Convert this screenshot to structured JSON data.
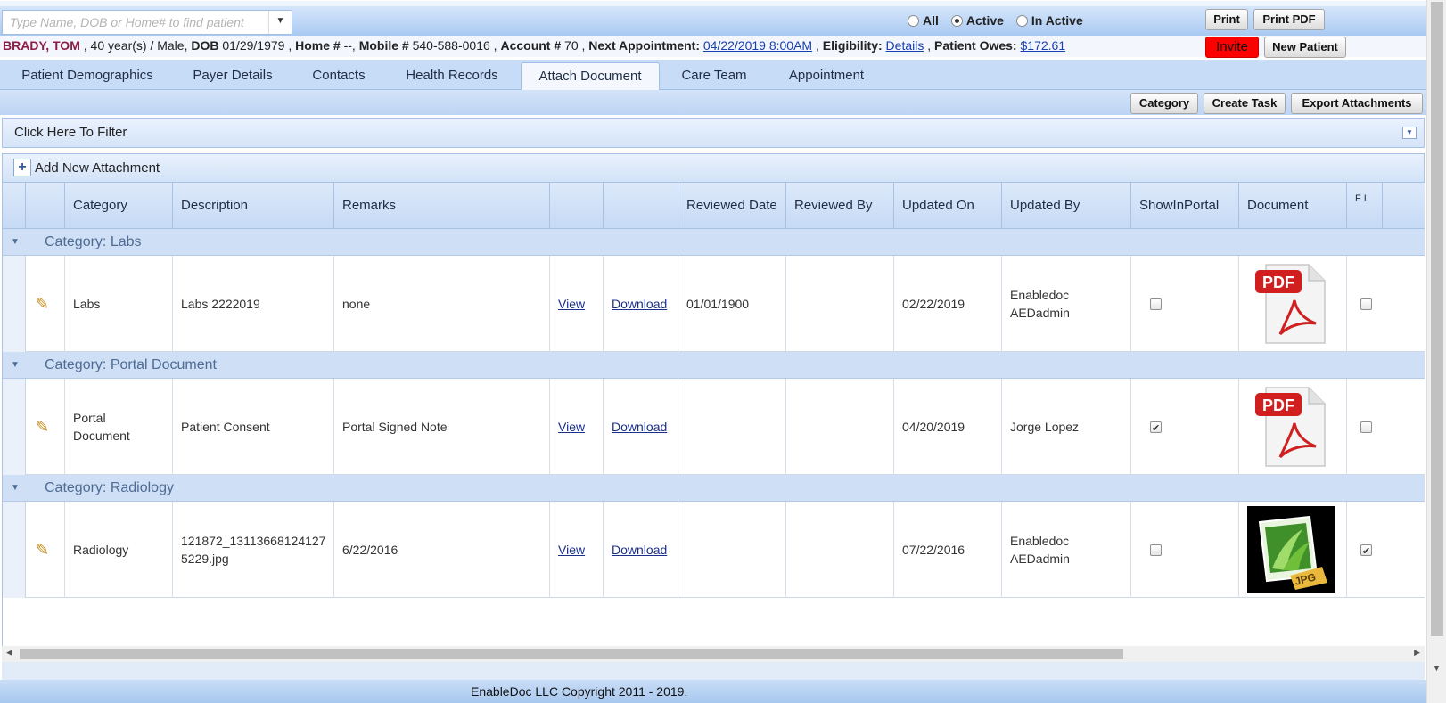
{
  "search": {
    "placeholder": "Type Name, DOB or Home# to find patient"
  },
  "status_filter": {
    "options": [
      "All",
      "Active",
      "In Active"
    ],
    "selected": "Active"
  },
  "top_buttons": {
    "print": "Print",
    "print_pdf": "Print PDF",
    "invite": "Invite",
    "new_patient": "New Patient"
  },
  "patient": {
    "name": "BRADY, TOM",
    "age_sex": " , 40 year(s) / Male, ",
    "dob_label": "DOB",
    "dob": " 01/29/1979 , ",
    "home_label": "Home #",
    "home": " --, ",
    "mobile_label": "Mobile #",
    "mobile": " 540-588-0016 , ",
    "account_label": "Account #",
    "account": " 70 , ",
    "next_appt_label": "Next Appointment:",
    "next_appt": "04/22/2019 8:00AM",
    "sep1": " , ",
    "eligibility_label": "Eligibility:",
    "eligibility": "Details",
    "sep2": " , ",
    "owes_label": "Patient Owes:",
    "owes": "$172.61"
  },
  "tabs": [
    {
      "label": "Patient Demographics"
    },
    {
      "label": "Payer Details"
    },
    {
      "label": "Contacts"
    },
    {
      "label": "Health Records"
    },
    {
      "label": "Attach Document",
      "active": true
    },
    {
      "label": "Care Team"
    },
    {
      "label": "Appointment"
    }
  ],
  "toolbar": {
    "category": "Category",
    "create_task": "Create Task",
    "export": "Export Attachments"
  },
  "filter": {
    "label": "Click Here To Filter"
  },
  "add_attachment": {
    "label": "Add New Attachment"
  },
  "table": {
    "columns": [
      "Category",
      "Description",
      "Remarks",
      "",
      "",
      "Reviewed Date",
      "Reviewed By",
      "Updated On",
      "Updated By",
      "ShowInPortal",
      "Document",
      "F I"
    ],
    "groups": [
      {
        "label": "Category: Labs",
        "row": {
          "category": "Labs",
          "description": "Labs 2222019",
          "remarks": "none",
          "view": "View",
          "download": "Download",
          "reviewed_date": "01/01/1900",
          "reviewed_by": "",
          "updated_on": "02/22/2019",
          "updated_by": "Enabledoc AEDadmin",
          "show_in_portal": false,
          "document_type": "PDF",
          "last_checked": false
        }
      },
      {
        "label": "Category: Portal Document",
        "row": {
          "category": "Portal Document",
          "description": "Patient Consent",
          "remarks": "Portal Signed Note",
          "view": "View",
          "download": "Download",
          "reviewed_date": "",
          "reviewed_by": "",
          "updated_on": "04/20/2019",
          "updated_by": "Jorge Lopez",
          "show_in_portal": true,
          "document_type": "PDF",
          "last_checked": false
        }
      },
      {
        "label": "Category: Radiology",
        "row": {
          "category": "Radiology",
          "description": "121872_131136681241275229.jpg",
          "remarks": "6/22/2016",
          "view": "View",
          "download": "Download",
          "reviewed_date": "",
          "reviewed_by": "",
          "updated_on": "07/22/2016",
          "updated_by": "Enabledoc AEDadmin",
          "show_in_portal": false,
          "document_type": "JPG",
          "last_checked": true
        }
      }
    ]
  },
  "footer": {
    "copyright": "EnableDoc LLC Copyright 2011 - 2019."
  },
  "colors": {
    "invite_bg": "#ff0000",
    "patient_name": "#8b1d45",
    "link": "#1a3fae",
    "header_blue": "#c7dcf7"
  }
}
